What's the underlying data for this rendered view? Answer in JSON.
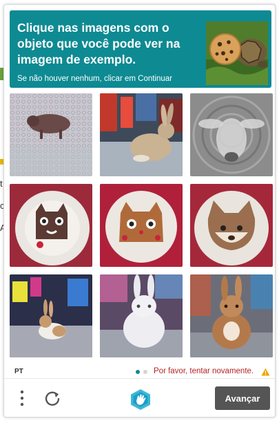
{
  "prompt": {
    "title": "Clique nas imagens com o objeto que você pode ver na imagem de exemplo.",
    "subtitle": "Se não houver nenhum, clicar em Continuar",
    "background_color": "#0e8a93"
  },
  "example_image": {
    "subject": "cookie and turtle"
  },
  "tiles": [
    {
      "subject": "animal noisy"
    },
    {
      "subject": "rabbit city street"
    },
    {
      "subject": "sheep noisy"
    },
    {
      "subject": "cat face cookie plate"
    },
    {
      "subject": "cat face cookie plate"
    },
    {
      "subject": "cat face cookie plate"
    },
    {
      "subject": "rabbit times square"
    },
    {
      "subject": "white rabbit city"
    },
    {
      "subject": "brown rabbit city"
    }
  ],
  "footer": {
    "language": "PT",
    "error_message": "Por favor, tentar novamente.",
    "error_color": "#b52424",
    "warning_icon": "warning-icon",
    "page_indicator": {
      "current": 1,
      "total": 2
    },
    "menu_icon": "kebab-menu-icon",
    "refresh_icon": "refresh-icon",
    "logo_icon": "hcaptcha-logo-icon",
    "next_label": "Avançar"
  }
}
